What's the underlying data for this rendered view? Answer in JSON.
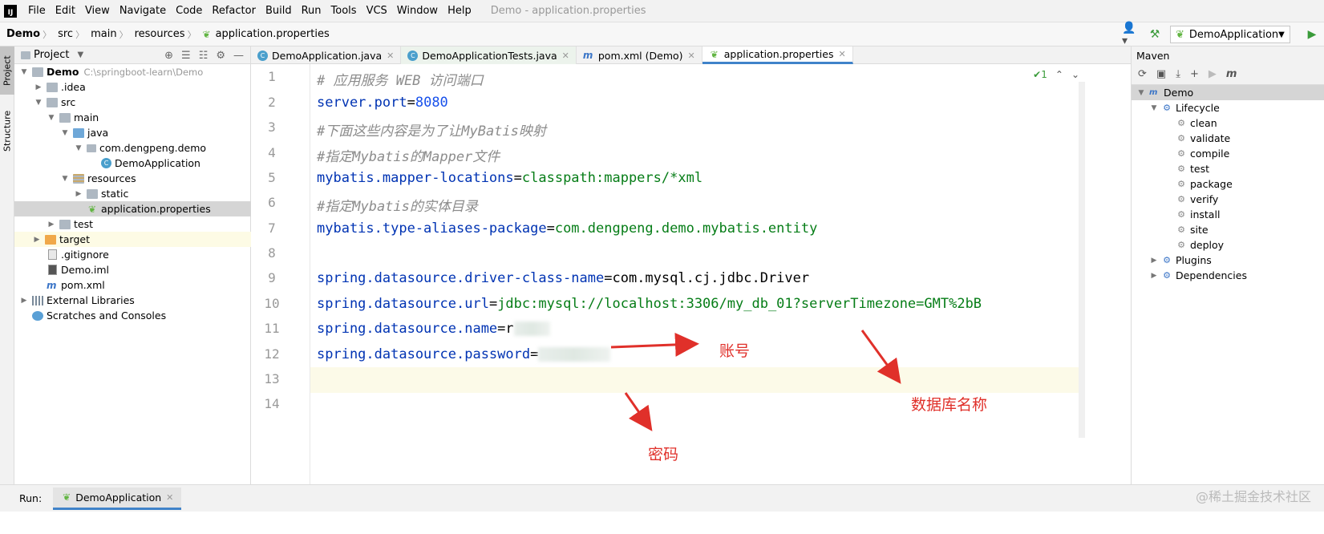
{
  "app": {
    "logo_text": "IJ",
    "window_title": "Demo - application.properties"
  },
  "menu": [
    "File",
    "Edit",
    "View",
    "Navigate",
    "Code",
    "Refactor",
    "Build",
    "Run",
    "Tools",
    "VCS",
    "Window",
    "Help"
  ],
  "breadcrumb": [
    "Demo",
    "src",
    "main",
    "resources",
    "application.properties"
  ],
  "run_config": {
    "label": "DemoApplication"
  },
  "left_tabs": {
    "project": "Project",
    "structure": "Structure"
  },
  "project_panel": {
    "title": "Project",
    "tree": [
      {
        "label": "Demo",
        "path": "C:\\springboot-learn\\Demo"
      },
      {
        "label": ".idea"
      },
      {
        "label": "src"
      },
      {
        "label": "main"
      },
      {
        "label": "java"
      },
      {
        "label": "com.dengpeng.demo"
      },
      {
        "label": "DemoApplication"
      },
      {
        "label": "resources"
      },
      {
        "label": "static"
      },
      {
        "label": "application.properties"
      },
      {
        "label": "test"
      },
      {
        "label": "target"
      },
      {
        "label": ".gitignore"
      },
      {
        "label": "Demo.iml"
      },
      {
        "label": "pom.xml"
      },
      {
        "label": "External Libraries"
      },
      {
        "label": "Scratches and Consoles"
      }
    ]
  },
  "tabs": [
    {
      "label": "DemoApplication.java"
    },
    {
      "label": "DemoApplicationTests.java"
    },
    {
      "label": "pom.xml (Demo)"
    },
    {
      "label": "application.properties"
    }
  ],
  "editor": {
    "inspection_count": "1",
    "line_numbers": [
      "1",
      "2",
      "3",
      "4",
      "5",
      "6",
      "7",
      "8",
      "9",
      "10",
      "11",
      "12",
      "13",
      "14"
    ],
    "lines": {
      "l1": "# 应用服务 WEB 访问端口",
      "l2_key": "server.port",
      "l2_val": "8080",
      "l3": "#下面这些内容是为了让MyBatis映射",
      "l4": "#指定Mybatis的Mapper文件",
      "l5_key": "mybatis.mapper-locations",
      "l5_val": "classpath:mappers/*xml",
      "l6": "#指定Mybatis的实体目录",
      "l7_key": "mybatis.type-aliases-package",
      "l7_val": "com.dengpeng.demo.mybatis.entity",
      "l9_key": "spring.datasource.driver-class-name",
      "l9_val": "com.mysql.cj.jdbc.Driver",
      "l10_key": "spring.datasource.url",
      "l10_val": "jdbc:mysql://localhost:3306/my_db_01?serverTimezone=GMT%2bB",
      "l11_key": "spring.datasource.name",
      "l11_val": "r",
      "l12_key": "spring.datasource.password"
    }
  },
  "annotations": {
    "account": "账号",
    "database_name": "数据库名称",
    "password": "密码"
  },
  "maven": {
    "title": "Maven",
    "project": "Demo",
    "lifecycle": "Lifecycle",
    "goals": [
      "clean",
      "validate",
      "compile",
      "test",
      "package",
      "verify",
      "install",
      "site",
      "deploy"
    ],
    "plugins": "Plugins",
    "dependencies": "Dependencies"
  },
  "runbar": {
    "label": "Run:",
    "tab": "DemoApplication"
  },
  "watermark": "@稀土掘金技术社区",
  "colors": {
    "accent": "#4083c9",
    "annotation": "#e0302a",
    "key": "#0033b3",
    "value": "#067d17"
  }
}
